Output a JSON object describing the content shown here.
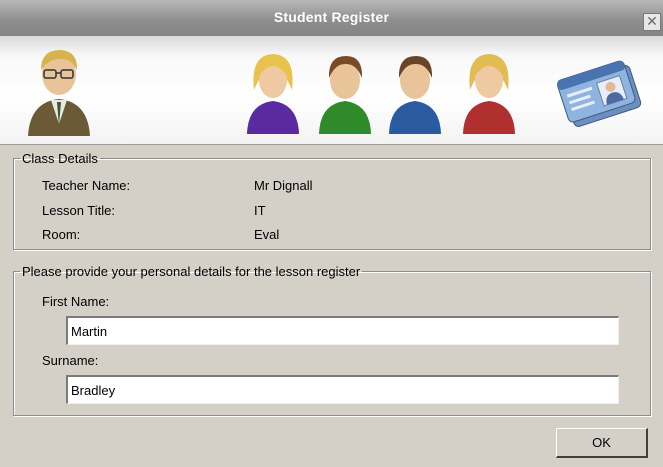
{
  "window": {
    "title": "Student Register",
    "close_glyph": "✕"
  },
  "banner": {
    "figures": [
      {
        "name": "teacher-avatar-icon",
        "color": "#5a4a2a"
      },
      {
        "name": "student-purple-avatar-icon",
        "color": "#5a2aa0"
      },
      {
        "name": "student-green-avatar-icon",
        "color": "#2f8a2a"
      },
      {
        "name": "student-blue-avatar-icon",
        "color": "#2a5aa0"
      },
      {
        "name": "student-red-avatar-icon",
        "color": "#b03030"
      }
    ],
    "card_icon": "id-card-icon"
  },
  "class_details": {
    "legend": "Class Details",
    "rows": [
      {
        "label": "Teacher Name:",
        "value": "Mr Dignall"
      },
      {
        "label": "Lesson Title:",
        "value": "IT"
      },
      {
        "label": "Room:",
        "value": "Eval"
      }
    ]
  },
  "personal": {
    "legend": "Please provide your personal details for the lesson register",
    "first_name_label": "First Name:",
    "first_name_value": "Martin",
    "surname_label": "Surname:",
    "surname_value": "Bradley"
  },
  "buttons": {
    "ok": "OK"
  }
}
